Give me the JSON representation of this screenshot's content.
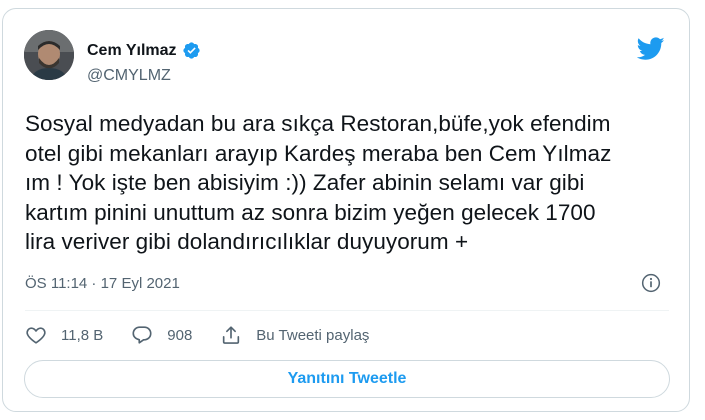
{
  "author": {
    "display_name": "Cem Yılmaz",
    "handle": "@CMYLMZ",
    "avatar_icon": "profile-photo",
    "verified_icon": "verified-badge-icon"
  },
  "brand": {
    "icon": "twitter-bird-icon",
    "color": "#1d9bf0"
  },
  "tweet": {
    "text": "Sosyal medyadan bu ara sıkça Restoran,büfe,yok efendim\notel gibi mekanları arayıp Kardeş meraba ben Cem Yılmaz\nım ! Yok işte ben abisiyim :)) Zafer abinin selamı var gibi\nkartım pinini unuttum az sonra bizim yeğen gelecek 1700\nlira veriver gibi dolandırıcılıklar  duyuyorum +",
    "timestamp": "ÖS 11:14 · 17 Eyl 2021"
  },
  "actions": {
    "likes": "11,8 B",
    "replies": "908",
    "share_label": "Bu Tweeti paylaş"
  },
  "reply_button": {
    "label": "Yanıtını Tweetle"
  },
  "colors": {
    "text": "#0f1419",
    "secondary": "#536471",
    "border": "#cfd9de",
    "accent": "#1d9bf0"
  }
}
